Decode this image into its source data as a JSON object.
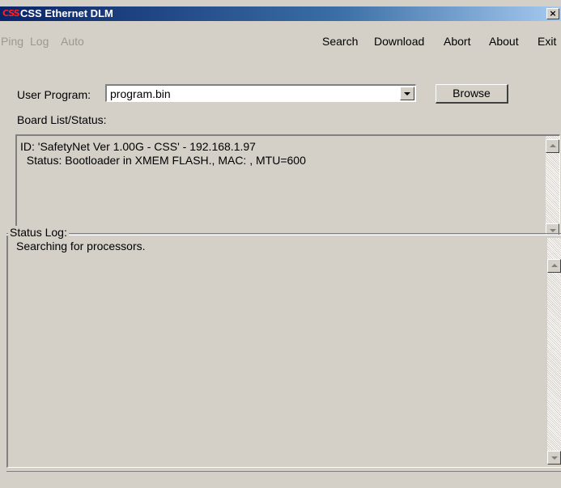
{
  "window": {
    "title": "CSS Ethernet DLM",
    "icon_text": "CSS",
    "close_glyph": "×"
  },
  "menu": {
    "left_items": [
      {
        "label": "Ping",
        "enabled": false
      },
      {
        "label": "Log",
        "enabled": false
      },
      {
        "label": "Auto",
        "enabled": false
      }
    ],
    "right_items": [
      {
        "label": "Search"
      },
      {
        "label": "Download"
      },
      {
        "label": "Abort"
      },
      {
        "label": "About"
      },
      {
        "label": "Exit"
      }
    ]
  },
  "program": {
    "label": "User Program:",
    "value": "program.bin",
    "browse_label": "Browse"
  },
  "board": {
    "label": "Board List/Status:",
    "lines": [
      "ID: 'SafetyNet Ver 1.00G - CSS' - 192.168.1.97",
      "  Status: Bootloader in XMEM FLASH., MAC: , MTU=600"
    ]
  },
  "log": {
    "label": "Status Log:",
    "lines": [
      "Searching for processors."
    ]
  },
  "colors": {
    "face": "#d4d0c8",
    "title_start": "#0a246a",
    "title_end": "#a6caf0",
    "disabled_text": "#9a9890"
  }
}
